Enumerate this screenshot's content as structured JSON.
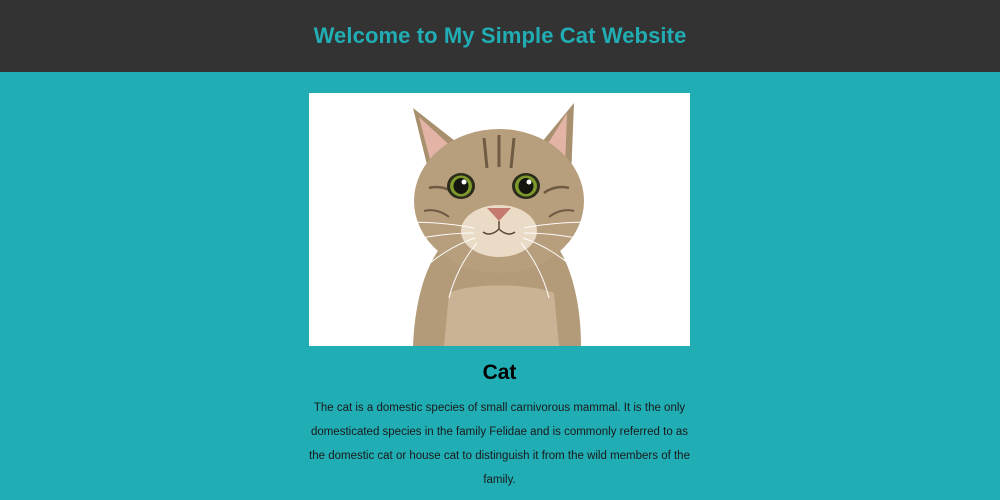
{
  "header": {
    "title": "Welcome to My Simple Cat Website"
  },
  "card": {
    "heading": "Cat",
    "description": "The cat is a domestic species of small carnivorous mammal. It is the only domesticated species in the family Felidae and is commonly referred to as the domestic cat or house cat to distinguish it from the wild members of the family."
  },
  "colors": {
    "page_background": "#20adb4",
    "header_background": "#333333",
    "title_color": "#20adb4",
    "photo_background": "#ffffff"
  },
  "icons": {
    "photo": "tabby-cat-photo"
  }
}
